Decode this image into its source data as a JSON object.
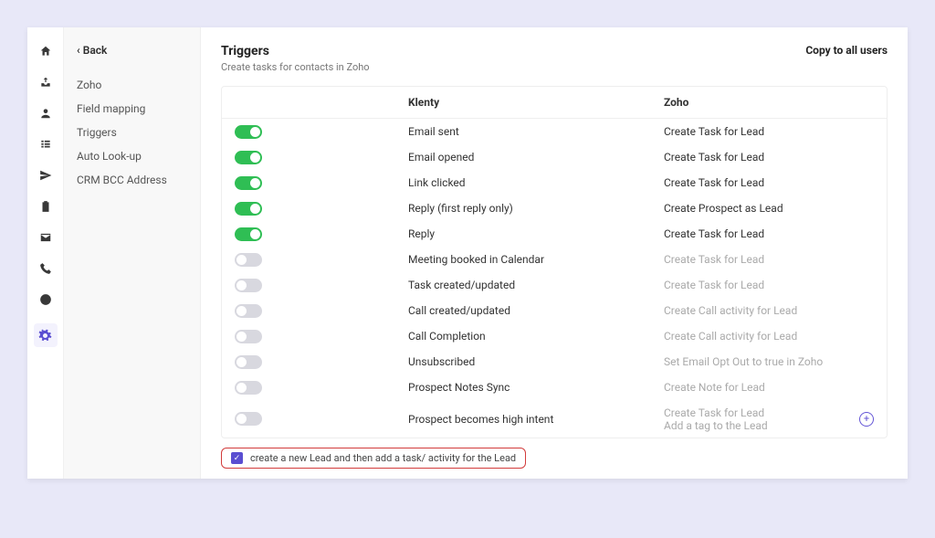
{
  "sidebar": {
    "back_label": "Back",
    "items": [
      {
        "label": "Zoho"
      },
      {
        "label": "Field mapping"
      },
      {
        "label": "Triggers"
      },
      {
        "label": "Auto Look-up"
      },
      {
        "label": "CRM BCC Address"
      }
    ]
  },
  "header": {
    "title": "Triggers",
    "subtitle": "Create tasks for contacts in Zoho",
    "copy_label": "Copy to all users"
  },
  "table": {
    "col_klenty": "Klenty",
    "col_zoho": "Zoho",
    "rows": [
      {
        "on": true,
        "klenty": "Email sent",
        "zoho": "Create Task for Lead"
      },
      {
        "on": true,
        "klenty": "Email opened",
        "zoho": "Create Task for Lead"
      },
      {
        "on": true,
        "klenty": "Link clicked",
        "zoho": "Create Task for Lead"
      },
      {
        "on": true,
        "klenty": "Reply (first reply only)",
        "zoho": "Create Prospect as Lead"
      },
      {
        "on": true,
        "klenty": "Reply",
        "zoho": "Create Task for Lead"
      },
      {
        "on": false,
        "klenty": "Meeting booked in Calendar",
        "zoho": "Create Task for Lead"
      },
      {
        "on": false,
        "klenty": "Task created/updated",
        "zoho": "Create Task for Lead"
      },
      {
        "on": false,
        "klenty": "Call created/updated",
        "zoho": "Create Call activity for Lead"
      },
      {
        "on": false,
        "klenty": "Call Completion",
        "zoho": "Create Call activity for Lead"
      },
      {
        "on": false,
        "klenty": "Unsubscribed",
        "zoho": "Set Email Opt Out to true in Zoho"
      },
      {
        "on": false,
        "klenty": "Prospect Notes Sync",
        "zoho": "Create Note for Lead"
      },
      {
        "on": false,
        "klenty": "Prospect becomes high intent",
        "zoho": "Create Task for Lead",
        "zoho2": "Add a tag to the Lead",
        "plus": true
      }
    ]
  },
  "footer": {
    "checkbox_label": "create a new Lead and then add a task/ activity for the Lead"
  }
}
